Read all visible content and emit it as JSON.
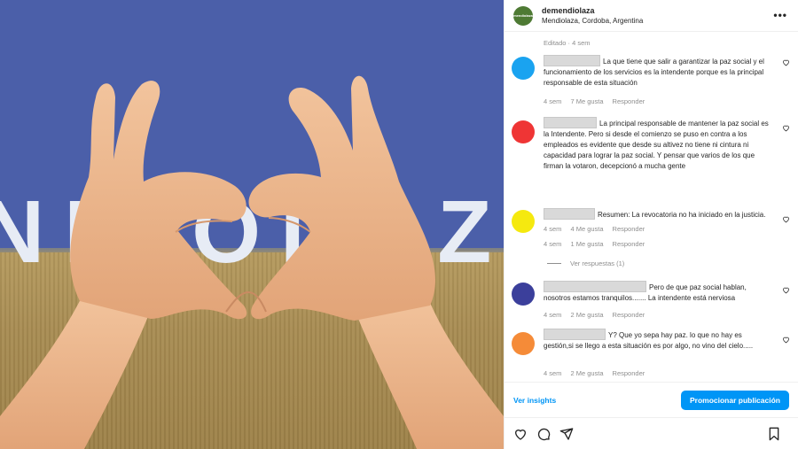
{
  "media": {
    "overlay_word": "NDIOLAZ"
  },
  "header": {
    "username": "demendiolaza",
    "location": "Mendiolaza, Cordoba, Argentina",
    "logo_text": "mendiolaza",
    "more_label": "•••"
  },
  "edited_label": "Editado · 4 sem",
  "comments": [
    {
      "avatar_color": "#1aa3f0",
      "text": "La que tiene que salir a garantizar la paz social y el funcionamiento de los servicios es la intendente porque es la principal responsable de esta situación",
      "time": "4 sem",
      "likes": "7 Me gusta",
      "reply": "Responder"
    },
    {
      "avatar_color": "#ef3535",
      "text": "La principal responsable de mantener la paz social es la Intendente. Pero si desde el comienzo se puso en contra a los empleados es evidente que desde su altivez no tiene ni cintura ni capacidad para lograr la paz social. Y pensar que varios de los que firman la votaron, decepcionó a mucha gente",
      "time": "4 sem",
      "likes": "4 Me gusta",
      "reply": "Responder"
    },
    {
      "avatar_color": "#f5e90f",
      "text": "Resumen: La revocatoria no ha iniciado en la justicia.",
      "time": "4 sem",
      "likes": "1 Me gusta",
      "reply": "Responder",
      "view_replies": "Ver respuestas (1)"
    },
    {
      "avatar_color": "#3b3f9b",
      "text": "Pero de que paz social hablan, nosotros estamos tranquilos....... La intendente está nerviosa",
      "time": "4 sem",
      "likes": "2 Me gusta",
      "reply": "Responder"
    },
    {
      "avatar_color": "#f58b38",
      "text": "Y? Que yo sepa hay paz. lo que no hay es gestión,si se llego a esta situación es por algo, no vino del cielo.....",
      "time": "4 sem",
      "likes": "2 Me gusta",
      "reply": "Responder"
    }
  ],
  "footer": {
    "insights_label": "Ver insights",
    "promote_label": "Promocionar publicación"
  }
}
